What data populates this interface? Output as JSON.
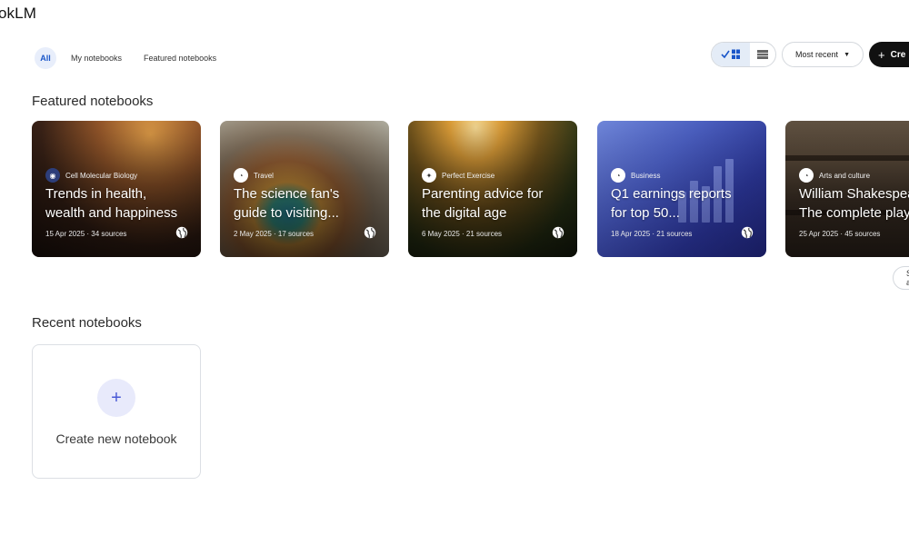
{
  "app": {
    "title": "okLM"
  },
  "tabs": [
    {
      "label": "All",
      "active": true
    },
    {
      "label": "My notebooks",
      "active": false
    },
    {
      "label": "Featured notebooks",
      "active": false
    }
  ],
  "toolbar": {
    "sort_label": "Most recent",
    "create_label": "Cre",
    "view_icons": [
      "check-icon",
      "grid-view-icon",
      "list-view-icon"
    ]
  },
  "sections": {
    "featured_title": "Featured notebooks",
    "recent_title": "Recent notebooks"
  },
  "featured_cards": [
    {
      "category": "Cell Molecular Biology",
      "title_line1": "Trends in health,",
      "title_line2": "wealth and happiness",
      "meta": "15 Apr 2025 · 34 sources"
    },
    {
      "category": "Travel",
      "title_line1": "The science fan's",
      "title_line2": "guide to visiting...",
      "meta": "2 May 2025 · 17 sources"
    },
    {
      "category": "Perfect Exercise",
      "title_line1": "Parenting advice for",
      "title_line2": "the digital age",
      "meta": "6 May 2025 · 21 sources"
    },
    {
      "category": "Business",
      "title_line1": "Q1 earnings reports",
      "title_line2": "for top 50...",
      "meta": "18 Apr 2025 · 21 sources"
    },
    {
      "category": "Arts and culture",
      "title_line1": "William Shakespeare:",
      "title_line2": "The complete plays",
      "meta": "25 Apr 2025 · 45 sources"
    }
  ],
  "see_all_label": "See all",
  "create_card": {
    "plus": "+",
    "label": "Create new notebook"
  },
  "colors": {
    "accent": "#1a56c9",
    "create_button": "#111111",
    "plus_bg": "#e8eafb"
  }
}
